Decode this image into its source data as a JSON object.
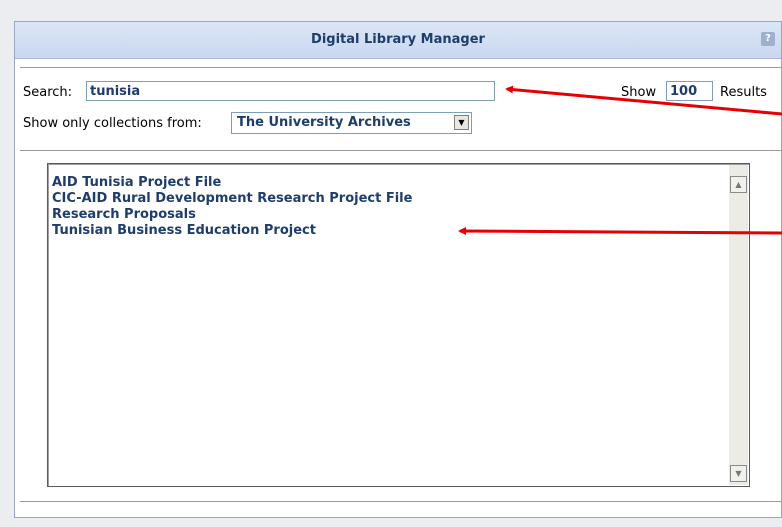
{
  "window": {
    "title": "Digital Library Manager",
    "help_icon": "help-icon",
    "help_glyph": "?"
  },
  "search": {
    "label": "Search:",
    "value": "tunisia",
    "show_label": "Show",
    "show_value": "100",
    "results_label": "Results"
  },
  "filter": {
    "label": "Show only collections from:",
    "selected": "The University Archives",
    "arrow": "▼"
  },
  "results": {
    "items": [
      "AID Tunisia Project File",
      "CIC-AID Rural Development Research Project File",
      "Research Proposals",
      "Tunisian Business Education Project"
    ]
  },
  "scrollbar": {
    "up_glyph": "▲",
    "down_glyph": "▼"
  },
  "annotations": {
    "arrow_color": "#e60000"
  }
}
